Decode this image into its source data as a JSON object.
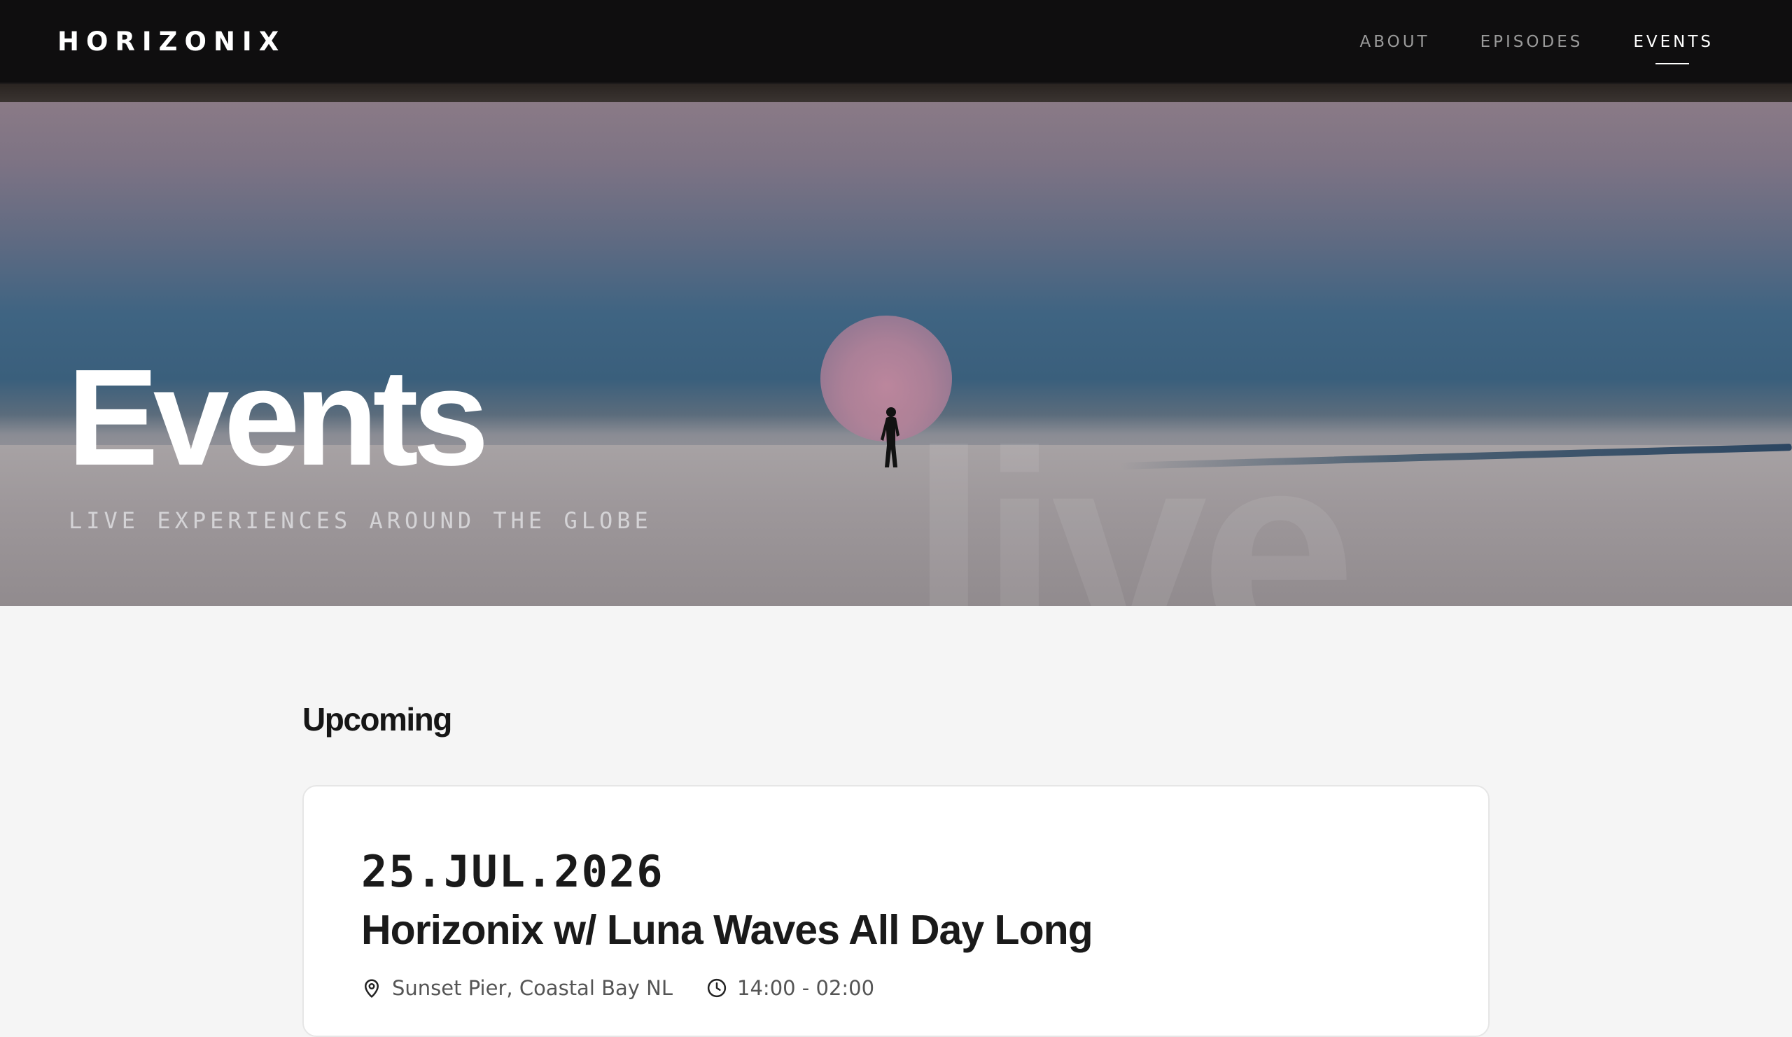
{
  "brand": "HORIZONIX",
  "nav": {
    "items": [
      {
        "label": "ABOUT",
        "active": false
      },
      {
        "label": "EPISODES",
        "active": false
      },
      {
        "label": "EVENTS",
        "active": true
      }
    ]
  },
  "hero": {
    "title": "Events",
    "subtitle": "LIVE EXPERIENCES AROUND THE GLOBE",
    "watermark": "live"
  },
  "upcoming": {
    "heading": "Upcoming",
    "events": [
      {
        "date": "25.JUL.2026",
        "title": "Horizonix w/ Luna Waves All Day Long",
        "location": "Sunset Pier, Coastal Bay NL",
        "time": "14:00 - 02:00",
        "location_icon": "map-pin-icon",
        "time_icon": "clock-icon"
      }
    ]
  },
  "colors": {
    "topbar": "#0f0e0f",
    "page_background": "#f5f5f5",
    "card_background": "#ffffff",
    "text_dark": "#1a1a1a",
    "nav_inactive": "#9a9a9a",
    "nav_active": "#ffffff"
  }
}
